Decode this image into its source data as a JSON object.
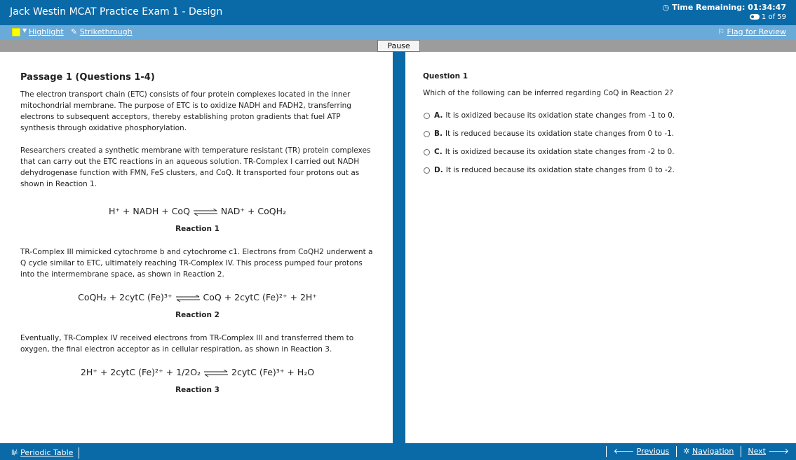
{
  "header": {
    "title": "Jack Westin MCAT Practice Exam 1 - Design",
    "timer_label": "Time Remaining:",
    "timer_value": "01:34:47",
    "question_count": "1 of 59"
  },
  "toolbar": {
    "highlight_label": "Highlight",
    "strikethrough_label": "Strikethrough",
    "flag_label": "Flag for Review",
    "highlight_color": "#ffff00"
  },
  "pause_label": "Pause",
  "passage": {
    "title": "Passage 1 (Questions 1-4)",
    "paragraphs": [
      "The electron transport chain (ETC) consists of four protein complexes located in the inner mitochondrial membrane. The purpose of ETC is to oxidize NADH and FADH2, transferring electrons to subsequent acceptors, thereby establishing proton gradients that fuel ATP synthesis through oxidative phosphorylation.",
      "Researchers created a synthetic membrane with temperature resistant (TR) protein complexes that can carry out the ETC reactions in an aqueous solution. TR-Complex I carried out NADH dehydrogenase function with FMN, FeS clusters, and CoQ. It transported four protons out as shown in Reaction 1.",
      "TR-Complex III mimicked cytochrome b and cytochrome c1. Electrons from CoQH2 underwent a Q cycle similar to ETC, ultimately reaching TR-Complex IV. This process pumped four protons into the intermembrane space, as shown in Reaction 2.",
      "Eventually, TR-Complex IV received electrons from TR-Complex III and transferred them to oxygen, the final electron acceptor as in cellular respiration, as shown in Reaction 3."
    ],
    "reactions": [
      {
        "left": "H⁺ + NADH + CoQ",
        "right": "NAD⁺ + CoQH₂",
        "label": "Reaction 1"
      },
      {
        "left": "CoQH₂ + 2cytC (Fe)³⁺",
        "right": "CoQ + 2cytC (Fe)²⁺ + 2H⁺",
        "label": "Reaction 2"
      },
      {
        "left": "2H⁺ + 2cytC (Fe)²⁺ + 1/2O₂",
        "right": "2cytC (Fe)³⁺ + H₂O",
        "label": "Reaction 3"
      }
    ]
  },
  "question": {
    "title": "Question 1",
    "text": "Which of the following can be inferred regarding CoQ in Reaction 2?",
    "choices": [
      {
        "letter": "A.",
        "text": "It is oxidized because its oxidation state changes from -1 to 0."
      },
      {
        "letter": "B.",
        "text": "It is reduced because its oxidation state changes from 0 to -1."
      },
      {
        "letter": "C.",
        "text": "It is oxidized because its oxidation state changes from -2 to 0."
      },
      {
        "letter": "D.",
        "text": "It is reduced because its oxidation state changes from 0 to -2."
      }
    ]
  },
  "footer": {
    "periodic_table_label": "Periodic Table",
    "previous_label": "Previous",
    "navigation_label": "Navigation",
    "next_label": "Next"
  },
  "colors": {
    "primary_blue": "#0a6aa8",
    "toolbar_blue": "#6aaad9",
    "pause_bar_gray": "#9c9c9c"
  }
}
